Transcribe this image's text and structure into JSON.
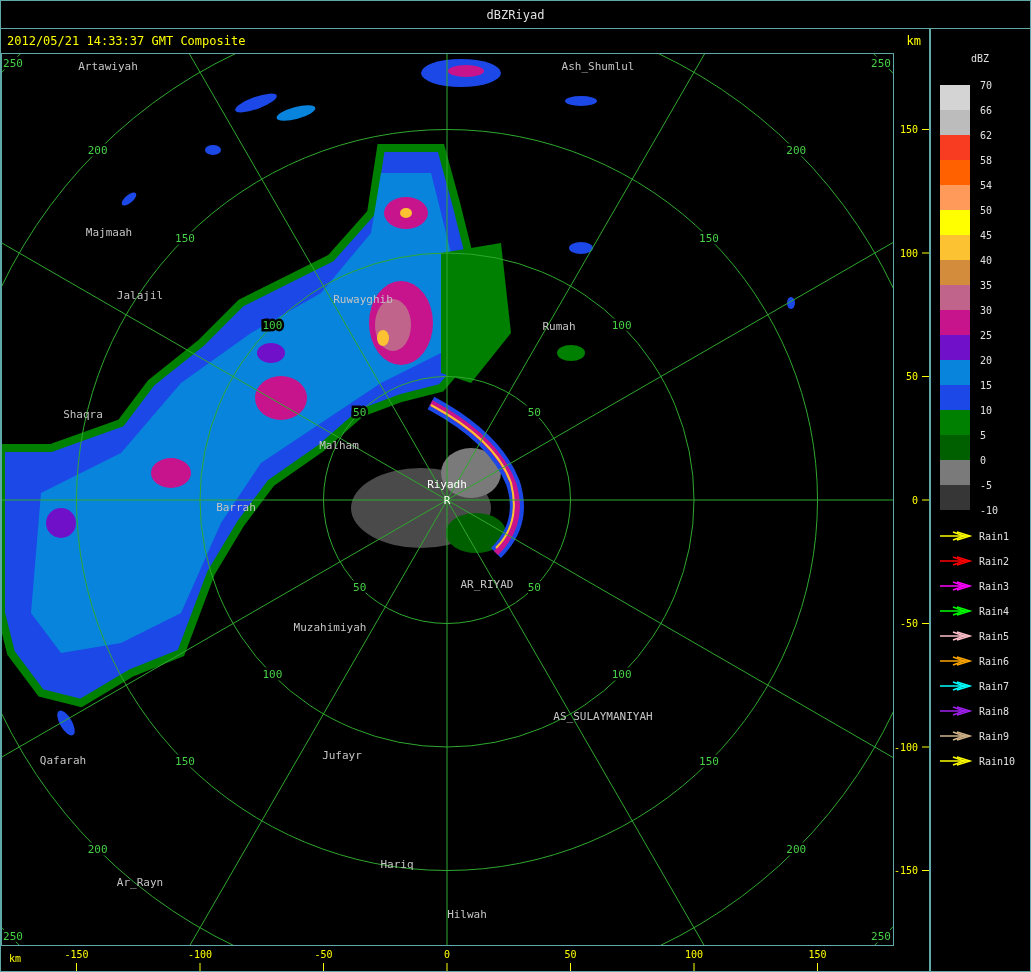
{
  "window": {
    "title": "dBZRiyad"
  },
  "header": {
    "timestamp": "2012/05/21 14:33:37 GMT Composite",
    "unit": "km"
  },
  "map": {
    "range_rings": [
      {
        "labels": [
          "50",
          "50",
          "50",
          "50"
        ]
      },
      {
        "labels": [
          "100",
          "100",
          "100",
          "100"
        ]
      },
      {
        "labels": [
          "150",
          "150",
          "150",
          "150"
        ]
      },
      {
        "labels": [
          "200",
          "200",
          "200",
          "200"
        ]
      },
      {
        "labels": [
          "250",
          "250",
          "250",
          "250"
        ]
      }
    ],
    "station": {
      "name": "Riyadh",
      "marker": "R"
    },
    "cities": [
      "Artawiyah",
      "Ash_Shumlul",
      "Majmaah",
      "Jalajil",
      "Ruwayghib",
      "Rumah",
      "Shaqra",
      "Malham",
      "Barrah",
      "AR_RIYAD",
      "Muzahimiyah",
      "AS_SULAYMANIYAH",
      "Jufayr",
      "Qafarah",
      "Hariq",
      "Ar_Rayn",
      "Hilwah"
    ]
  },
  "y_axis": {
    "ticks": [
      "150",
      "100",
      "50",
      "0",
      "-50",
      "-100",
      "-150"
    ]
  },
  "x_axis": {
    "unit": "km",
    "ticks": [
      "-150",
      "-100",
      "-50",
      "0",
      "50",
      "100",
      "150"
    ]
  },
  "legend": {
    "title": "dBZ",
    "levels": [
      "70",
      "66",
      "62",
      "58",
      "54",
      "50",
      "45",
      "40",
      "35",
      "30",
      "25",
      "20",
      "15",
      "10",
      "5",
      "0",
      "-5",
      "-10"
    ],
    "bands": [
      {
        "color": "#d4d4d4"
      },
      {
        "color": "#bcbcbc"
      },
      {
        "color": "#f83c22"
      },
      {
        "color": "#ff6000"
      },
      {
        "color": "#ff9a5a"
      },
      {
        "color": "#ffff00"
      },
      {
        "color": "#fcc232"
      },
      {
        "color": "#d28c3c"
      },
      {
        "color": "#c0648c"
      },
      {
        "color": "#c8148c"
      },
      {
        "color": "#7010c8"
      },
      {
        "color": "#0884dc"
      },
      {
        "color": "#1c48e8"
      },
      {
        "color": "#008000"
      },
      {
        "color": "#006000"
      },
      {
        "color": "#7a7a7a"
      },
      {
        "color": "#363636"
      }
    ],
    "tracks": [
      {
        "label": "Rain1",
        "color": "#ffff00"
      },
      {
        "label": "Rain2",
        "color": "#ff0000"
      },
      {
        "label": "Rain3",
        "color": "#ff00ff"
      },
      {
        "label": "Rain4",
        "color": "#00ff00"
      },
      {
        "label": "Rain5",
        "color": "#ffc0cb"
      },
      {
        "label": "Rain6",
        "color": "#ffa500"
      },
      {
        "label": "Rain7",
        "color": "#00ffff"
      },
      {
        "label": "Rain8",
        "color": "#a020f0"
      },
      {
        "label": "Rain9",
        "color": "#d2b48c"
      },
      {
        "label": "Rain10",
        "color": "#ffff00"
      }
    ]
  }
}
